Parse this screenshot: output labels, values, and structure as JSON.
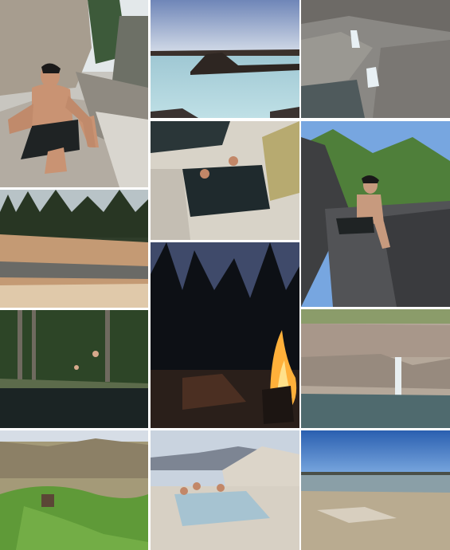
{
  "collage": {
    "photos": [
      {
        "subject": "man-sitting-on-rock",
        "colors": {
          "sky": "#dfe6ea",
          "rock": "#a79d8f",
          "skin": "#c99373",
          "shorts": "#1f2324"
        }
      },
      {
        "subject": "lake-with-rock-island-at-dusk",
        "colors": {
          "sky": "#8fa6c9",
          "water": "#a9cfd9",
          "land": "#3a302b"
        }
      },
      {
        "subject": "granite-cascade-creek",
        "colors": {
          "rock": "#8a8884",
          "water": "#4f5a5c",
          "foam": "#e8f0f4"
        }
      },
      {
        "subject": "white-rock-hot-pool-with-bathers",
        "colors": {
          "rock": "#d8d3c8",
          "water": "#1f2a2d",
          "moss": "#b7aa70"
        }
      },
      {
        "subject": "man-crouching-on-dark-rock",
        "colors": {
          "sky": "#77a6e0",
          "trees": "#4f7f3a",
          "rock": "#3e3f41"
        }
      },
      {
        "subject": "river-slabs-under-pines",
        "colors": {
          "forest": "#2f3d2a",
          "rock": "#c49a74",
          "water": "#6a6a66"
        }
      },
      {
        "subject": "campfire-at-night",
        "colors": {
          "sky": "#3f4a6a",
          "trees": "#0d1015",
          "fire": "#ffb03a"
        }
      },
      {
        "subject": "forest-pond-figures",
        "colors": {
          "trees": "#2d4527",
          "water": "#1b2424"
        }
      },
      {
        "subject": "waterfall-into-pool",
        "colors": {
          "rock": "#b5a89a",
          "water": "#4f6a6e",
          "falls": "#e8eef0"
        }
      },
      {
        "subject": "green-hillside-hot-spring-tub",
        "colors": {
          "hills": "#a49a78",
          "grass": "#5f9a38"
        }
      },
      {
        "subject": "travertine-hot-pool-with-bathers",
        "colors": {
          "sky": "#c9d3df",
          "rock": "#dcd5c9",
          "water": "#a6c3d1"
        }
      },
      {
        "subject": "dry-lakebed-under-blue-sky",
        "colors": {
          "sky": "#2f6fbf",
          "ground": "#b9ab90",
          "water": "#8a9fa7"
        }
      }
    ]
  }
}
